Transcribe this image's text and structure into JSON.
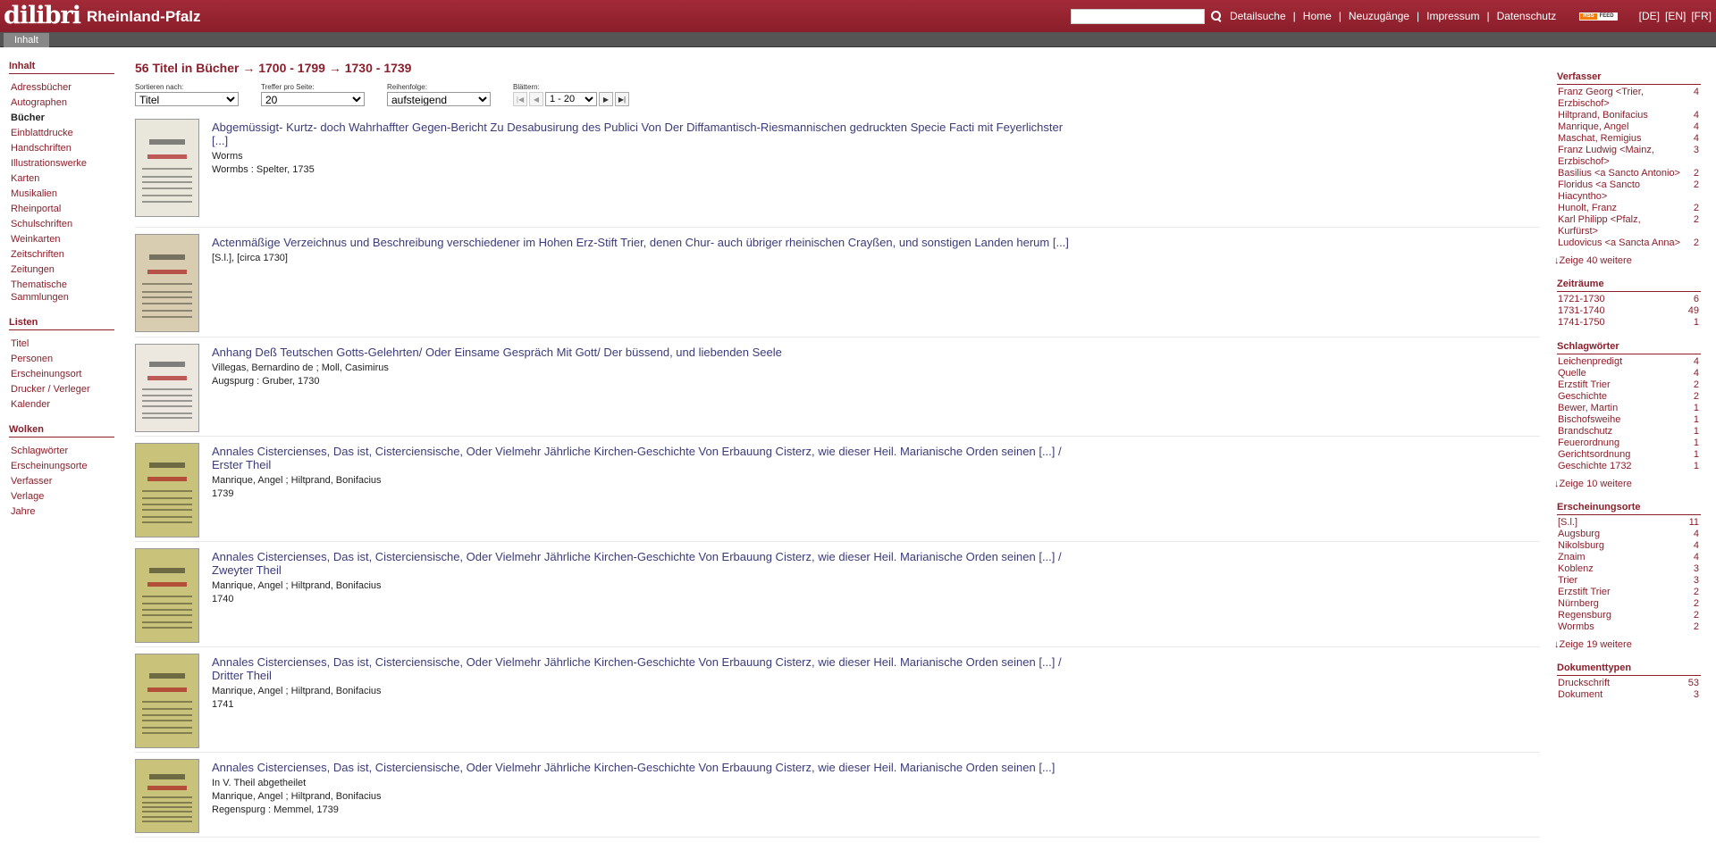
{
  "header": {
    "logo_mark": "dilibri",
    "logo_region": "Rheinland-Pfalz",
    "search_value": "",
    "nav": [
      "Detailsuche",
      "Home",
      "Neuzugänge",
      "Impressum",
      "Datenschutz"
    ],
    "rss_left": "RSS",
    "rss_right": "FEED",
    "langs": [
      "[DE]",
      "[EN]",
      "[FR]"
    ]
  },
  "tab": {
    "label": "Inhalt"
  },
  "sidebar": {
    "groups": [
      {
        "title": "Inhalt",
        "items": [
          "Adressbücher",
          "Autographen",
          "Bücher",
          "Einblattdrucke",
          "Handschriften",
          "Illustrationswerke",
          "Karten",
          "Musikalien",
          "Rheinportal",
          "Schulschriften",
          "Weinkarten",
          "Zeitschriften",
          "Zeitungen",
          "Thematische Sammlungen"
        ],
        "active": "Bücher"
      },
      {
        "title": "Listen",
        "items": [
          "Titel",
          "Personen",
          "Erscheinungsort",
          "Drucker / Verleger",
          "Kalender"
        ]
      },
      {
        "title": "Wolken",
        "items": [
          "Schlagwörter",
          "Erscheinungsorte",
          "Verfasser",
          "Verlage",
          "Jahre"
        ]
      }
    ]
  },
  "main": {
    "title": "56 Titel in Bücher → 1700 - 1799 → 1730 - 1739",
    "controls": {
      "sort_label": "Sortieren nach:",
      "sort_value": "Titel",
      "per_page_label": "Treffer pro Seite:",
      "per_page_value": "20",
      "order_label": "Reihenfolge:",
      "order_value": "aufsteigend",
      "page_label": "Blättern:",
      "page_value": "1 - 20"
    },
    "results": [
      {
        "title": "Abgemüssigt- Kurtz- doch Wahrhaffter Gegen-Bericht Zu Desabusirung des Publici Von Der Diffamantisch-Riesmannischen gedruckten Specie Facti mit Feyerlichster [...]",
        "lines": [
          "Worms",
          "Wormbs : Spelter, 1735"
        ],
        "thumb_color": "#e9e6dc"
      },
      {
        "title": "Actenmäßige Verzeichnus und Beschreibung verschiedener im Hohen Erz-Stift Trier, denen Chur- auch übriger rheinischen Crayßen, und sonstigen Landen herum [...]",
        "lines": [
          "[S.l.], [circa 1730]"
        ],
        "thumb_color": "#d8cdb0"
      },
      {
        "title": "Anhang Deß Teutschen Gotts-Gelehrten/ Oder Einsame Gespräch Mit Gott/ Der büssend, und liebenden Seele",
        "lines": [
          "Villegas, Bernardino de ; Moll, Casimirus",
          "Augspurg : Gruber, 1730"
        ],
        "thumb_color": "#ece8e0"
      },
      {
        "title": "Annales Cistercienses, Das ist, Cisterciensische, Oder Vielmehr Jährliche Kirchen-Geschichte Von Erbauung Cisterz, wie dieser Heil. Marianische Orden seinen [...] / Erster Theil",
        "lines": [
          "Manrique, Angel ; Hiltprand, Bonifacius",
          "1739"
        ],
        "thumb_color": "#c9c27a"
      },
      {
        "title": "Annales Cistercienses, Das ist, Cisterciensische, Oder Vielmehr Jährliche Kirchen-Geschichte Von Erbauung Cisterz, wie dieser Heil. Marianische Orden seinen [...] / Zweyter Theil",
        "lines": [
          "Manrique, Angel ; Hiltprand, Bonifacius",
          "1740"
        ],
        "thumb_color": "#c9c27a"
      },
      {
        "title": "Annales Cistercienses, Das ist, Cisterciensische, Oder Vielmehr Jährliche Kirchen-Geschichte Von Erbauung Cisterz, wie dieser Heil. Marianische Orden seinen [...] / Dritter Theil",
        "lines": [
          "Manrique, Angel ; Hiltprand, Bonifacius",
          "1741"
        ],
        "thumb_color": "#c9c27a"
      },
      {
        "title": "Annales Cistercienses, Das ist, Cisterciensische, Oder Vielmehr Jährliche Kirchen-Geschichte Von Erbauung Cisterz, wie dieser Heil. Marianische Orden seinen [...]",
        "lines": [
          "In V. Theil abgetheilet",
          "Manrique, Angel ; Hiltprand, Bonifacius",
          "Regenspurg : Memmel, 1739"
        ],
        "thumb_color": "#c9c27a"
      }
    ]
  },
  "facets": [
    {
      "title": "Verfasser",
      "rows": [
        [
          "Franz Georg <Trier, Erzbischof>",
          "4"
        ],
        [
          "Hiltprand, Bonifacius",
          "4"
        ],
        [
          "Manrique, Angel",
          "4"
        ],
        [
          "Maschat, Remigius",
          "4"
        ],
        [
          "Franz Ludwig <Mainz, Erzbischof>",
          "3"
        ],
        [
          "Basilius <a Sancto Antonio>",
          "2"
        ],
        [
          "Floridus <a Sancto Hiacyntho>",
          "2"
        ],
        [
          "Hunolt, Franz",
          "2"
        ],
        [
          "Karl Philipp <Pfalz, Kurfürst>",
          "2"
        ],
        [
          "Ludovicus <a Sancta Anna>",
          "2"
        ]
      ],
      "more": "Zeige 40 weitere"
    },
    {
      "title": "Zeiträume",
      "rows": [
        [
          "1721-1730",
          "6"
        ],
        [
          "1731-1740",
          "49"
        ],
        [
          "1741-1750",
          "1"
        ]
      ],
      "more": ""
    },
    {
      "title": "Schlagwörter",
      "rows": [
        [
          "Leichenpredigt",
          "4"
        ],
        [
          "Quelle",
          "4"
        ],
        [
          "Erzstift Trier",
          "2"
        ],
        [
          "Geschichte",
          "2"
        ],
        [
          "Bewer, Martin",
          "1"
        ],
        [
          "Bischofsweihe",
          "1"
        ],
        [
          "Brandschutz",
          "1"
        ],
        [
          "Feuerordnung",
          "1"
        ],
        [
          "Gerichtsordnung",
          "1"
        ],
        [
          "Geschichte 1732",
          "1"
        ]
      ],
      "more": "Zeige 10 weitere"
    },
    {
      "title": "Erscheinungsorte",
      "rows": [
        [
          "[S.l.]",
          "11"
        ],
        [
          "Augsburg",
          "4"
        ],
        [
          "Nikolsburg",
          "4"
        ],
        [
          "Znaim",
          "4"
        ],
        [
          "Koblenz",
          "3"
        ],
        [
          "Trier",
          "3"
        ],
        [
          "Erzstift Trier",
          "2"
        ],
        [
          "Nürnberg",
          "2"
        ],
        [
          "Regensburg",
          "2"
        ],
        [
          "Wormbs",
          "2"
        ]
      ],
      "more": "Zeige 19 weitere"
    },
    {
      "title": "Dokumenttypen",
      "rows": [
        [
          "Druckschrift",
          "53"
        ],
        [
          "Dokument",
          "3"
        ]
      ],
      "more": ""
    }
  ],
  "colors": {
    "brand": "#8a1e2a",
    "link": "#3b3b7b"
  },
  "icons": [
    "search-icon",
    "rss-feed-icon",
    "pager-first-icon",
    "pager-prev-icon",
    "pager-next-icon",
    "pager-last-icon"
  ]
}
